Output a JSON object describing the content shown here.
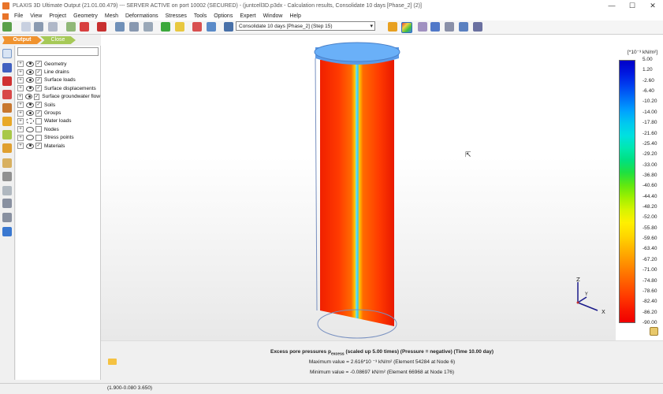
{
  "window": {
    "title": "PLAXIS 3D Ultimate Output (21.01.00.479) --- SERVER ACTIVE on port 10002 (SECURED) - (juntcell3D.p3dx - Calculation results, Consolidate 10 days [Phase_2] (2)]",
    "min": "—",
    "max": "☐",
    "close": "✕"
  },
  "menu": [
    "File",
    "View",
    "Project",
    "Geometry",
    "Mesh",
    "Deformations",
    "Stresses",
    "Tools",
    "Options",
    "Expert",
    "Window",
    "Help"
  ],
  "toolbar": {
    "step_value": "Consolidate 10 days [Phase_2] (Step 15)"
  },
  "tabs": {
    "output": "Output",
    "close": "Close"
  },
  "explorer": {
    "search_placeholder": "",
    "items": [
      {
        "label": "Geometry",
        "eye": "on",
        "checked": true
      },
      {
        "label": "Line drains",
        "eye": "on",
        "checked": true
      },
      {
        "label": "Surface loads",
        "eye": "on",
        "checked": true
      },
      {
        "label": "Surface displacements",
        "eye": "on",
        "checked": true
      },
      {
        "label": "Surface groundwater flow",
        "eye": "on",
        "checked": true
      },
      {
        "label": "Soils",
        "eye": "on",
        "checked": true
      },
      {
        "label": "Groups",
        "eye": "on",
        "checked": true
      },
      {
        "label": "Water loads",
        "eye": "half",
        "checked": false
      },
      {
        "label": "Nodes",
        "eye": "off",
        "checked": false
      },
      {
        "label": "Stress points",
        "eye": "off",
        "checked": false
      },
      {
        "label": "Materials",
        "eye": "on",
        "checked": true
      }
    ]
  },
  "legend": {
    "units": "[*10⁻³ kN/m²]",
    "labels": [
      "5.00",
      "1.20",
      "-2.60",
      "-6.40",
      "-10.20",
      "-14.00",
      "-17.80",
      "-21.60",
      "-25.40",
      "-29.20",
      "-33.00",
      "-36.80",
      "-40.60",
      "-44.40",
      "-48.20",
      "-52.00",
      "-55.80",
      "-59.60",
      "-63.40",
      "-67.20",
      "-71.00",
      "-74.80",
      "-78.60",
      "-82.40",
      "-86.20",
      "-90.00"
    ],
    "colors": [
      "#0000c8",
      "#0018e0",
      "#0040f0",
      "#0070f8",
      "#00a0ff",
      "#00c8f0",
      "#00e0e0",
      "#00e8b0",
      "#00e080",
      "#20e040",
      "#60e810",
      "#a0f000",
      "#d8f400",
      "#fff000",
      "#ffd800",
      "#ffb800",
      "#ff9800",
      "#ff7800",
      "#ff5800",
      "#ff3800",
      "#f81800",
      "#f00000"
    ]
  },
  "axes": {
    "x": "X",
    "y": "Y",
    "z": "Z"
  },
  "info": {
    "title_pre": "Excess pore pressures p",
    "title_sub": "excess",
    "title_post": " (scaled up 5.00 times) (Pressure = negative) (Time 10.00 day)",
    "max": "Maximum value = 2.616*10 ⁻³ kN/m² (Element 54284 at Node 6)",
    "min": "Minimum value = -0.08697 kN/m² (Element 66968 at Node 176)"
  },
  "status": {
    "coords": "(1.900-0.080 3.650)"
  }
}
